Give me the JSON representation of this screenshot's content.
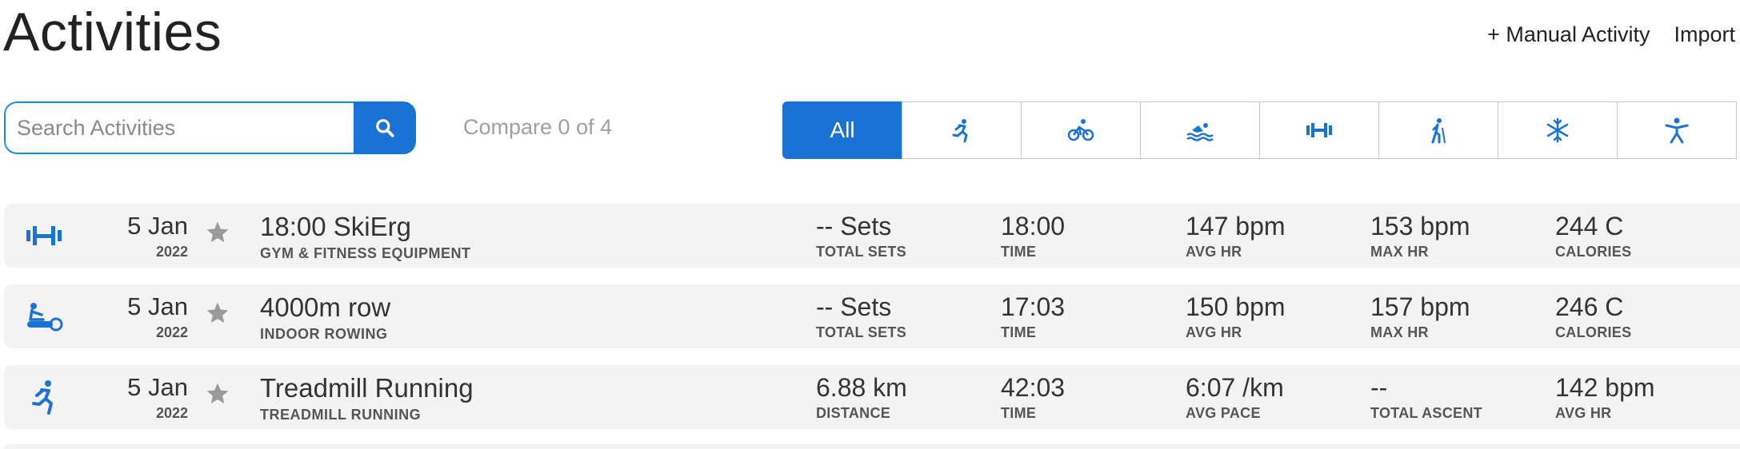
{
  "header": {
    "title": "Activities",
    "manual_activity": "+ Manual Activity",
    "import": "Import"
  },
  "search": {
    "placeholder": "Search Activities",
    "value": ""
  },
  "compare": "Compare 0 of 4",
  "filters": [
    {
      "label": "All",
      "icon": "all",
      "active": true
    },
    {
      "icon": "running-icon"
    },
    {
      "icon": "cycling-icon"
    },
    {
      "icon": "swimming-icon"
    },
    {
      "icon": "strength-icon"
    },
    {
      "icon": "hiking-icon"
    },
    {
      "icon": "winter-sports-icon"
    },
    {
      "icon": "other-activity-icon"
    }
  ],
  "accent_color": "#1a73d4",
  "activities": [
    {
      "icon": "strength-icon",
      "day": "5 Jan",
      "year": "2022",
      "name": "18:00 SkiErg",
      "type": "GYM & FITNESS EQUIPMENT",
      "stats": [
        {
          "value": "-- Sets",
          "label": "TOTAL SETS"
        },
        {
          "value": "18:00",
          "label": "TIME"
        },
        {
          "value": "147 bpm",
          "label": "AVG HR"
        },
        {
          "value": "153 bpm",
          "label": "MAX HR"
        },
        {
          "value": "244 C",
          "label": "CALORIES"
        }
      ]
    },
    {
      "icon": "rowing-icon",
      "day": "5 Jan",
      "year": "2022",
      "name": "4000m row",
      "type": "INDOOR ROWING",
      "stats": [
        {
          "value": "-- Sets",
          "label": "TOTAL SETS"
        },
        {
          "value": "17:03",
          "label": "TIME"
        },
        {
          "value": "150 bpm",
          "label": "AVG HR"
        },
        {
          "value": "157 bpm",
          "label": "MAX HR"
        },
        {
          "value": "246 C",
          "label": "CALORIES"
        }
      ]
    },
    {
      "icon": "running-icon",
      "day": "5 Jan",
      "year": "2022",
      "name": "Treadmill Running",
      "type": "TREADMILL RUNNING",
      "stats": [
        {
          "value": "6.88 km",
          "label": "DISTANCE"
        },
        {
          "value": "42:03",
          "label": "TIME"
        },
        {
          "value": "6:07 /km",
          "label": "AVG PACE"
        },
        {
          "value": "--",
          "label": "TOTAL ASCENT"
        },
        {
          "value": "142 bpm",
          "label": "AVG HR"
        }
      ]
    }
  ]
}
